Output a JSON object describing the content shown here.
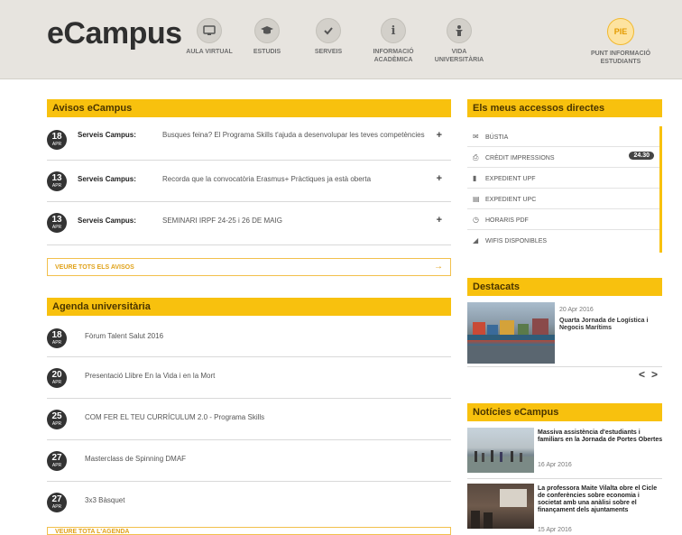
{
  "brand": {
    "logo": "eCampus"
  },
  "nav": [
    {
      "icon": "monitor-icon",
      "glyph": "▭",
      "label": "AULA VIRTUAL"
    },
    {
      "icon": "graduation-cap-icon",
      "glyph": "🎓",
      "label": "ESTUDIS"
    },
    {
      "icon": "check-icon",
      "glyph": "✓",
      "label": "SERVEIS"
    },
    {
      "icon": "info-icon",
      "glyph": "i",
      "label": "INFORMACIÓ ACADÈMICA"
    },
    {
      "icon": "person-icon",
      "glyph": "☗",
      "label": "VIDA UNIVERSITÀRIA"
    }
  ],
  "pie": {
    "badge": "PIE",
    "label": "PUNT INFORMACIÓ ESTUDIANTS"
  },
  "avisos": {
    "title": "Avisos eCampus",
    "items": [
      {
        "day": "18",
        "month": "APR",
        "source": "Serveis Campus:",
        "text": "Busques feina? El Programa Skills t'ajuda a desenvolupar les teves competències"
      },
      {
        "day": "13",
        "month": "APR",
        "source": "Serveis Campus:",
        "text": "Recorda que la convocatòria Erasmus+ Pràctiques ja està oberta"
      },
      {
        "day": "13",
        "month": "APR",
        "source": "Serveis Campus:",
        "text": "SEMINARI IRPF 24-25 i 26 DE MAIG"
      }
    ],
    "see_all": "VEURE TOTS ELS AVISOS",
    "see_all_arrow": "→"
  },
  "agenda": {
    "title": "Agenda universitària",
    "items": [
      {
        "day": "18",
        "month": "APR",
        "text": "Fòrum Talent Salut 2016"
      },
      {
        "day": "20",
        "month": "APR",
        "text": "Presentació Llibre En la Vida i en la Mort"
      },
      {
        "day": "25",
        "month": "APR",
        "text": "COM FER EL TEU CURRÍCULUM 2.0 - Programa Skills"
      },
      {
        "day": "27",
        "month": "APR",
        "text": "Masterclass de Spinning DMAF"
      },
      {
        "day": "27",
        "month": "APR",
        "text": "3x3 Bàsquet"
      }
    ],
    "see_all": "VEURE TOTA L'AGENDA"
  },
  "shortcuts": {
    "title": "Els meus accessos directes",
    "items": [
      {
        "icon": "mail-icon",
        "glyph": "✉",
        "label": "BÚSTIA",
        "badge": ""
      },
      {
        "icon": "printer-icon",
        "glyph": "⎙",
        "label": "CRÈDIT IMPRESSIONS",
        "badge": "24.30"
      },
      {
        "icon": "file-icon",
        "glyph": "▮",
        "label": "EXPEDIENT UPF",
        "badge": ""
      },
      {
        "icon": "document-icon",
        "glyph": "▤",
        "label": "EXPEDIENT UPC",
        "badge": ""
      },
      {
        "icon": "clock-icon",
        "glyph": "◷",
        "label": "HORARIS PDF",
        "badge": ""
      },
      {
        "icon": "wifi-icon",
        "glyph": "◢",
        "label": "WIFIS DISPONIBLES",
        "badge": ""
      }
    ]
  },
  "destacats": {
    "title": "Destacats",
    "date": "20 Apr 2016",
    "headline": "Quarta Jornada de Logística i Negocis Marítims",
    "prev": "<",
    "next": ">"
  },
  "news": {
    "title": "Notícies eCampus",
    "items": [
      {
        "headline": "Massiva assistència d'estudiants i familiars en la Jornada de Portes Obertes",
        "date": "16 Apr 2016"
      },
      {
        "headline": "La professora Maite Vilalta obre el Cicle de conferències sobre economia i societat amb una anàlisi sobre el finançament dels ajuntaments",
        "date": "15 Apr 2016"
      }
    ]
  }
}
